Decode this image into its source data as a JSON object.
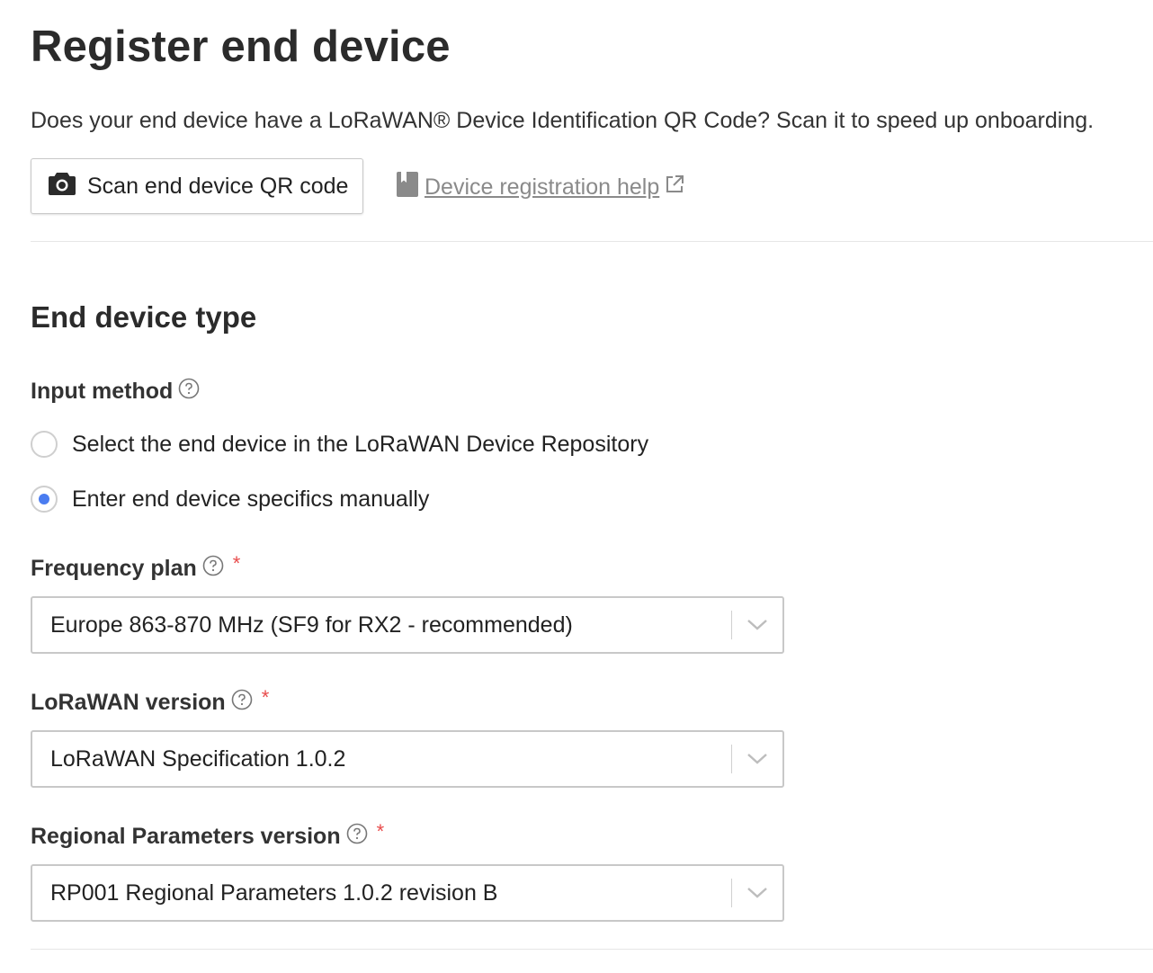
{
  "header": {
    "title": "Register end device",
    "intro": "Does your end device have a LoRaWAN® Device Identification QR Code? Scan it to speed up onboarding.",
    "scan_button_label": "Scan end device QR code",
    "scan_icon": "camera-icon",
    "help_link_label": "Device registration help",
    "help_icon": "book-icon",
    "external_icon": "external-link-icon"
  },
  "section": {
    "title": "End device type"
  },
  "input_method": {
    "label": "Input method",
    "options": [
      {
        "label": "Select the end device in the LoRaWAN Device Repository",
        "selected": false
      },
      {
        "label": "Enter end device specifics manually",
        "selected": true
      }
    ]
  },
  "frequency_plan": {
    "label": "Frequency plan",
    "required_mark": "*",
    "value": "Europe 863-870 MHz (SF9 for RX2 - recommended)"
  },
  "lorawan_version": {
    "label": "LoRaWAN version",
    "required_mark": "*",
    "value": "LoRaWAN Specification 1.0.2"
  },
  "regional_parameters": {
    "label": "Regional Parameters version",
    "required_mark": "*",
    "value": "RP001 Regional Parameters 1.0.2 revision B"
  },
  "colors": {
    "accent": "#4a7cf0",
    "required": "#e84b4b",
    "link": "#8a8a8a"
  }
}
